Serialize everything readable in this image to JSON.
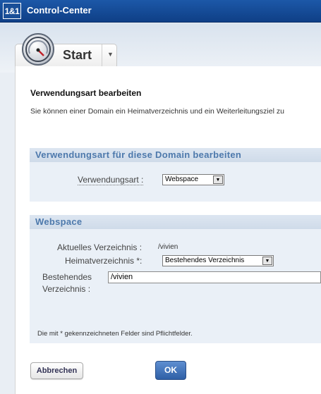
{
  "header": {
    "logo_text": "1&1",
    "app_title": "Control-Center"
  },
  "tab": {
    "label": "Start",
    "icon": "speedometer-icon",
    "menu_icon": "chevron-down-icon"
  },
  "page": {
    "title": "Verwendungsart bearbeiten",
    "intro": "Sie können einer Domain ein Heimatverzeichnis und ein Weiterleitungsziel zu"
  },
  "usage_section": {
    "heading": "Verwendungsart für diese Domain bearbeiten",
    "field_label": "Verwendungsart :",
    "selected": "Webspace"
  },
  "webspace_section": {
    "heading": "Webspace",
    "current_dir_label": "Aktuelles Verzeichnis :",
    "current_dir_value": "/vivien",
    "home_dir_label": "Heimatverzeichnis *:",
    "home_dir_selected": "Bestehendes Verzeichnis",
    "existing_dir_label_line1": "Bestehendes",
    "existing_dir_label_line2": "Verzeichnis :",
    "existing_dir_value": "/vivien",
    "footnote": "Die mit * gekennzeichneten Felder sind Pflichtfelder."
  },
  "buttons": {
    "cancel": "Abbrechen",
    "ok": "OK"
  },
  "colors": {
    "header_blue": "#174c96",
    "section_heading": "#4d79ac",
    "ok_button": "#3a6bb3"
  }
}
